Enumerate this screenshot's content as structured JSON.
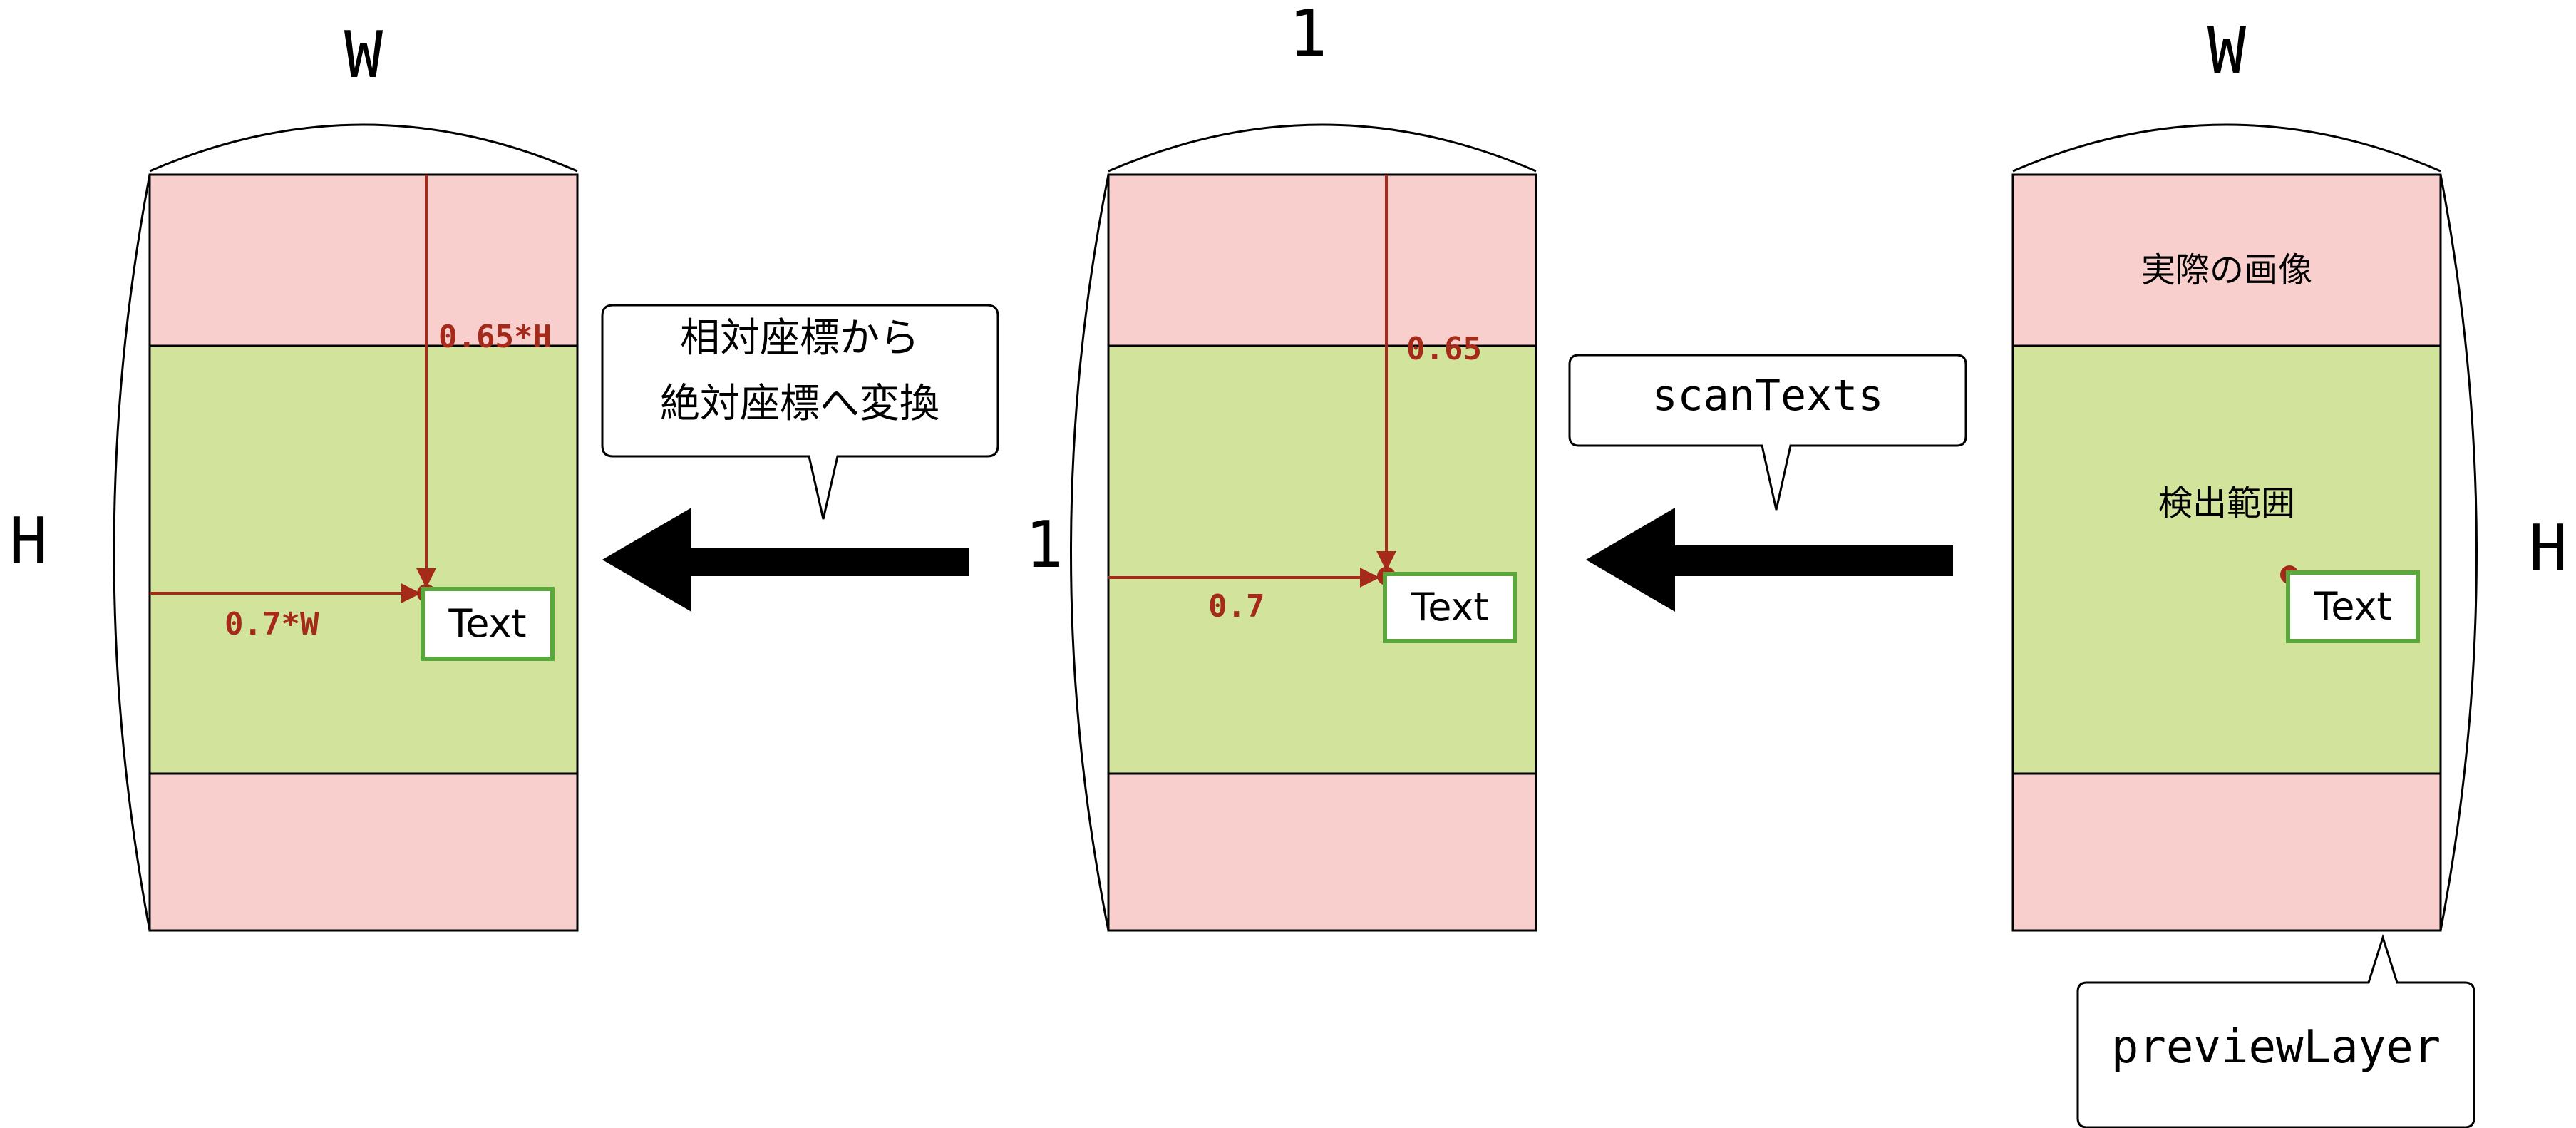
{
  "colors": {
    "red_zone": "#f8cfcc",
    "green_zone": "#d2e39c",
    "outline": "#000000",
    "pointer": "#a52a1a",
    "text_box_border": "#5aa83c",
    "background": "#ffffff"
  },
  "left_panel": {
    "width_label": "W",
    "height_label": "H",
    "y_offset_label": "0.65*H",
    "x_offset_label": "0.7*W",
    "text_box": "Text"
  },
  "middle_panel": {
    "width_label": "1",
    "height_label": "1",
    "y_offset_label": "0.65",
    "x_offset_label": "0.7",
    "text_box": "Text"
  },
  "right_panel": {
    "width_label": "W",
    "height_label": "H",
    "image_label": "実際の画像",
    "detection_label": "検出範囲",
    "text_box": "Text"
  },
  "callouts": {
    "conversion_line1": "相対座標から",
    "conversion_line2": "絶対座標へ変換",
    "scan_texts": "scanTexts",
    "preview_layer": "previewLayer"
  },
  "icons": {
    "flow_arrow": "left-arrow-icon"
  }
}
